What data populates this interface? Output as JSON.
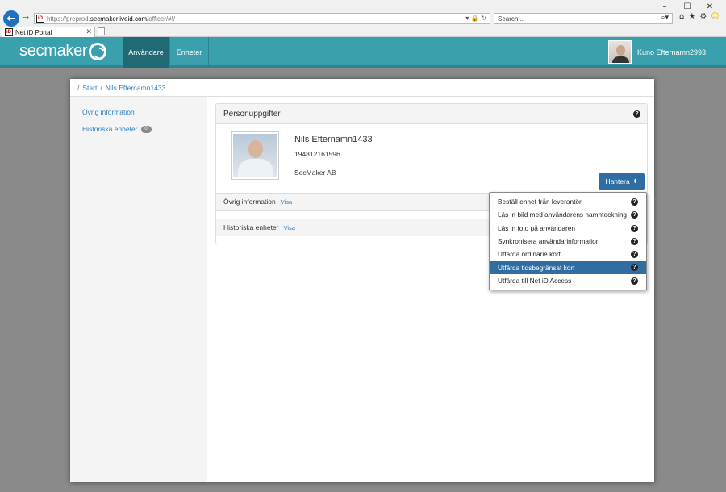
{
  "browser": {
    "url_prefix": "https://preprod.",
    "url_domain": "secmakerliveid.com",
    "url_path": "/officer/#!/",
    "search_placeholder": "Search...",
    "tab_title": "Net iD Portal",
    "site_icon_label": "iD",
    "window_controls": [
      "–",
      "☐",
      "✕"
    ]
  },
  "app": {
    "logo_text": "secmaker",
    "nav": [
      {
        "label": "Användare",
        "active": true
      },
      {
        "label": "Enheter",
        "active": false
      }
    ],
    "user_name": "Kuno Efternamn2993",
    "colors": {
      "header": "#3aa0ad",
      "nav_active": "#1f6a75",
      "primary": "#2f6da3",
      "link": "#2d7fbd"
    }
  },
  "breadcrumb": {
    "items": [
      "Start",
      "Nils Efternamn1433"
    ]
  },
  "sidebar": {
    "items": [
      {
        "label": "Övrig information"
      },
      {
        "label": "Historiska enheter",
        "badge": "0"
      }
    ]
  },
  "person": {
    "panel_title": "Personuppgifter",
    "name": "Nils Efternamn1433",
    "id_number": "194812161596",
    "organization": "SecMaker AB",
    "manage_button": "Hantera",
    "sections": [
      {
        "title": "Övrig information",
        "link": "Visa"
      },
      {
        "title": "Historiska enheter",
        "link": "Visa"
      }
    ]
  },
  "menu": {
    "items": [
      {
        "label": "Beställ enhet från leverantör",
        "selected": false
      },
      {
        "label": "Läs in bild med användarens namnteckning",
        "selected": false
      },
      {
        "label": "Läs in foto på användaren",
        "selected": false
      },
      {
        "label": "Synkronisera användarinformation",
        "selected": false
      },
      {
        "label": "Utfärda ordinarie kort",
        "selected": false
      },
      {
        "label": "Utfärda tidsbegränsat kort",
        "selected": true
      },
      {
        "label": "Utfärda till Net iD Access",
        "selected": false
      }
    ]
  }
}
